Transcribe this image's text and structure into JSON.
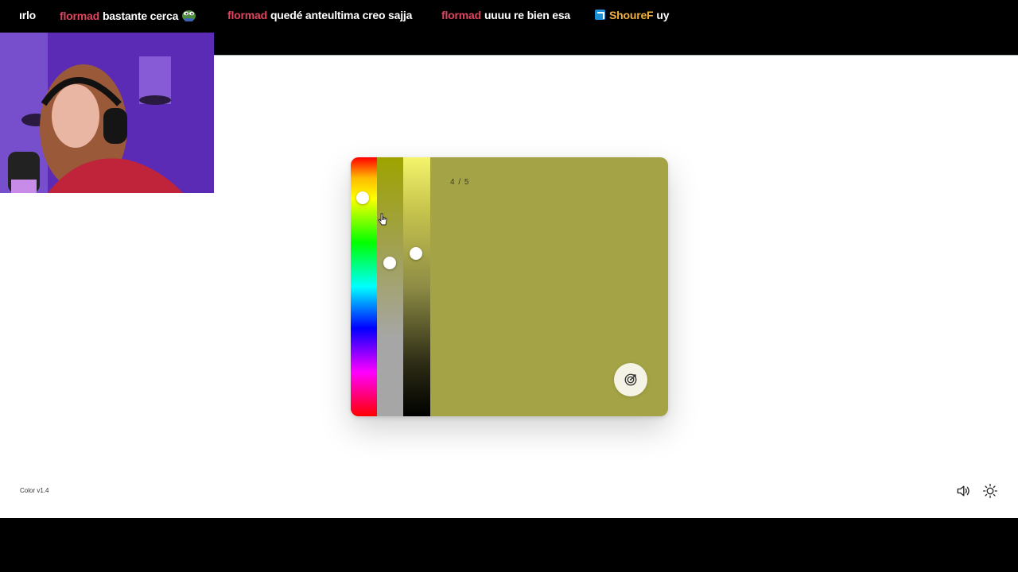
{
  "chat": {
    "messages": [
      {
        "user": "",
        "text": "ırlo"
      },
      {
        "user": "flormad",
        "text": "bastante cerca",
        "emote": "pepe-emote"
      },
      {
        "user": "flormad",
        "text": "quedé anteultima creo sajja"
      },
      {
        "user": "flormad",
        "text": "uuuu re bien esa"
      },
      {
        "user": "ShoureF",
        "text": "uy",
        "badge": "prime-badge"
      }
    ]
  },
  "game": {
    "counter": "4 / 5",
    "target_color": "#a4a446",
    "hue_level": 0.16,
    "saturation_level": 0.41,
    "lightness_level": 0.37,
    "submit_icon": "target-icon"
  },
  "footer": {
    "version": "Color v1.4",
    "sound_icon": "speaker-icon",
    "theme_icon": "sun-icon"
  }
}
